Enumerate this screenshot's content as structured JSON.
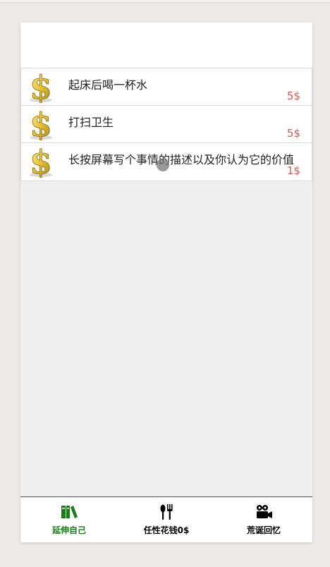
{
  "tasks": [
    {
      "title": "起床后喝一杯水",
      "price": "5$",
      "icon": "dollar-coin-icon"
    },
    {
      "title": "打扫卫生",
      "price": "5$",
      "icon": "dollar-coin-icon"
    },
    {
      "title": "长按屏幕写个事情的描述以及你认为它的价值",
      "price": "1$",
      "icon": "dollar-coin-icon"
    }
  ],
  "tabs": [
    {
      "label": "延伸自己",
      "icon": "books-icon",
      "active": true
    },
    {
      "label": "任性花钱0$",
      "icon": "fork-knife-icon",
      "active": false
    },
    {
      "label": "荒诞回忆",
      "icon": "video-camera-icon",
      "active": false
    }
  ],
  "colors": {
    "accent": "#1c7c1c",
    "price": "#e0574f"
  }
}
